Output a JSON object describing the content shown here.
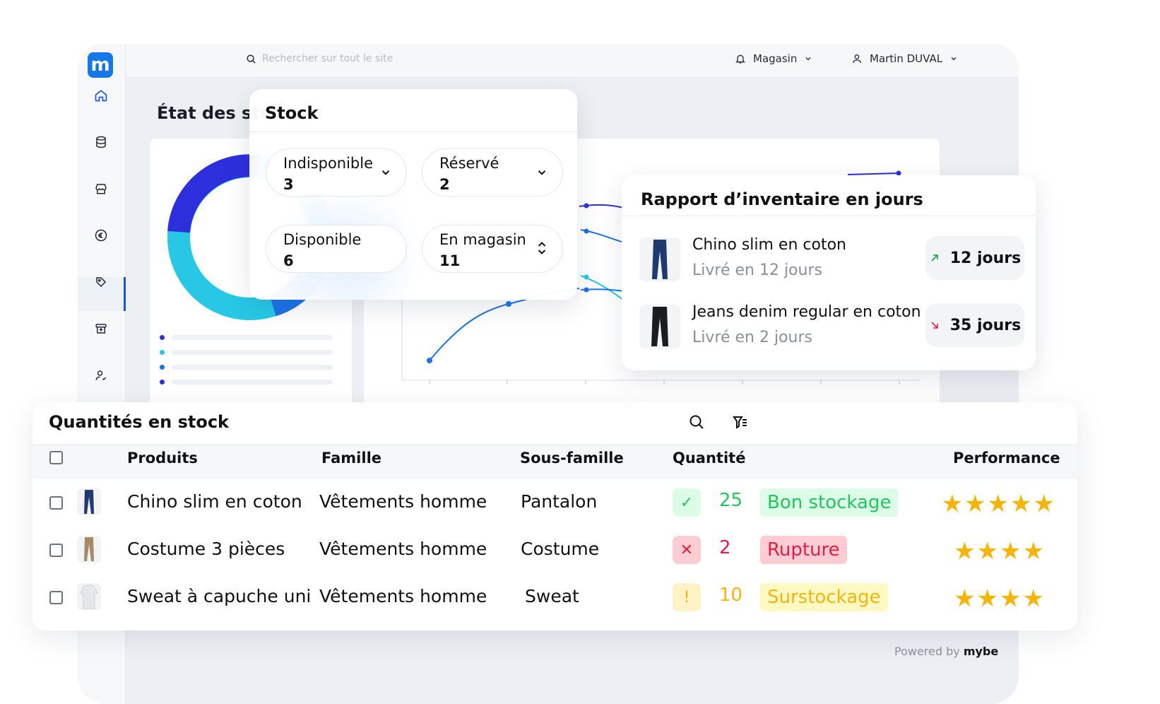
{
  "app": {
    "logo_letter": "m",
    "search_placeholder": "Rechercher sur tout le site",
    "magasin_label": "Magasin",
    "user_label": "Martin DUVAL",
    "page_title": "État des stoc"
  },
  "sidebar": {
    "items": [
      "home-icon",
      "database-icon",
      "store-icon",
      "euro-icon",
      "tag-icon",
      "archive-icon",
      "user-icon"
    ],
    "active": "tag-icon"
  },
  "stock": {
    "title": "Stock",
    "pills": [
      {
        "label": "Indisponible",
        "value": "3",
        "control": "chevron-down"
      },
      {
        "label": "Réservé",
        "value": "2",
        "control": "chevron-down"
      },
      {
        "label": "Disponible",
        "value": "6",
        "control": "none"
      },
      {
        "label": "En magasin",
        "value": "11",
        "control": "chevron-up-down"
      }
    ]
  },
  "rapport": {
    "title": "Rapport d’inventaire en jours",
    "rows": [
      {
        "name": "Chino slim en coton",
        "sub": "Livré en 12 jours",
        "days": "12 jours",
        "trend": "up",
        "trend_color": "#16a34a"
      },
      {
        "name": "Jeans denim regular en coton",
        "sub": "Livré en 2 jours",
        "days": "35 jours",
        "trend": "down",
        "trend_color": "#e11d48"
      }
    ]
  },
  "table": {
    "title": "Quantités en stock",
    "headers": {
      "produits": "Produits",
      "famille": "Famille",
      "sous_famille": "Sous-famille",
      "quantite": "Quantité",
      "performance": "Performance"
    },
    "rows": [
      {
        "produit": "Chino slim en coton",
        "famille": "Vêtements homme",
        "sous_famille": "Pantalon",
        "icon": "✓",
        "quantite": "25",
        "status": "Bon stockage",
        "stars": "★★★★★",
        "color": "#22c55e",
        "bg": "#dcfce7"
      },
      {
        "produit": "Costume 3 pièces",
        "famille": "Vêtements homme",
        "sous_famille": "Costume",
        "icon": "✕",
        "quantite": "2",
        "status": "Rupture",
        "stars": "★★★★",
        "color": "#e11d48",
        "bg": "#fecdd3"
      },
      {
        "produit": "Sweat à capuche uni",
        "famille": "Vêtements homme",
        "sous_famille": "Sweat",
        "icon": "!",
        "quantite": "10",
        "status": "Surstockage",
        "stars": "★★★★",
        "color": "#f5b40a",
        "bg": "#fef9c3"
      }
    ]
  },
  "footer": {
    "powered_by": "Powered by",
    "brand": "mybe"
  },
  "colors": {
    "accent": "#1677e8",
    "navy": "#2d2fdc",
    "cyan": "#28c7e6",
    "star": "#f5b40a"
  }
}
